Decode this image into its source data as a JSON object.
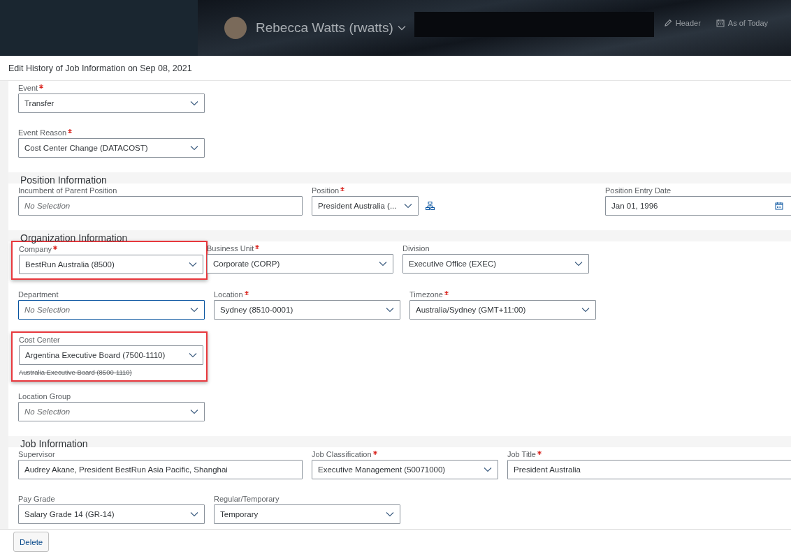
{
  "header": {
    "user_name": "Rebecca Watts (rwatts)",
    "actions": [
      {
        "kind": "edit",
        "label": "Header"
      },
      {
        "kind": "calendar",
        "label": "As of Today"
      }
    ]
  },
  "dialog": {
    "title": "Edit History of Job Information on Sep 08, 2021"
  },
  "sections": [
    {
      "rows": [
        {
          "fields": [
            {
              "label": "Event",
              "required": true,
              "kind": "select",
              "value": "Transfer"
            }
          ]
        },
        {
          "fields": [
            {
              "label": "Event Reason",
              "required": true,
              "kind": "select",
              "value": "Cost Center Change (DATACOST)"
            }
          ]
        }
      ]
    },
    {
      "title": "Position Information",
      "rows": [
        {
          "fields": [
            {
              "label": "Incumbent of Parent Position",
              "required": false,
              "kind": "input",
              "placeholder": "No Selection"
            },
            {
              "label": "Position",
              "required": true,
              "kind": "select-with-chart",
              "value": "President Australia (..."
            },
            {
              "label": "Position Entry Date",
              "required": false,
              "kind": "date",
              "value": "Jan 01, 1996"
            }
          ]
        }
      ]
    },
    {
      "title": "Organization Information",
      "rows": [
        {
          "fields": [
            {
              "label": "Company",
              "required": true,
              "kind": "select",
              "value": "BestRun Australia (8500)",
              "highlighted": true
            },
            {
              "label": "Business Unit",
              "required": true,
              "kind": "select",
              "value": "Corporate (CORP)"
            },
            {
              "label": "Division",
              "required": false,
              "kind": "select",
              "value": "Executive Office (EXEC)"
            }
          ]
        },
        {
          "fields": [
            {
              "label": "Department",
              "required": false,
              "kind": "select",
              "placeholder": "No Selection",
              "focused": true
            },
            {
              "label": "Location",
              "required": true,
              "kind": "select",
              "value": "Sydney (8510-0001)"
            },
            {
              "label": "Timezone",
              "required": true,
              "kind": "select",
              "value": "Australia/Sydney (GMT+11:00)"
            }
          ]
        },
        {
          "fields": [
            {
              "label": "Cost Center",
              "required": false,
              "kind": "select",
              "value": "Argentina Executive Board (7500-1110)",
              "previous_value": "Australia Executive Board (8500-1110)",
              "highlighted": true
            }
          ]
        },
        {
          "fields": [
            {
              "label": "Location Group",
              "required": false,
              "kind": "select",
              "placeholder": "No Selection"
            }
          ]
        }
      ]
    },
    {
      "title": "Job Information",
      "rows": [
        {
          "fields": [
            {
              "label": "Supervisor",
              "required": false,
              "kind": "input",
              "value": "Audrey Akane, President BestRun Asia Pacific, Shanghai"
            },
            {
              "label": "Job Classification",
              "required": true,
              "kind": "select",
              "value": "Executive Management (50071000)"
            },
            {
              "label": "Job Title",
              "required": true,
              "kind": "input",
              "value": "President Australia"
            }
          ]
        },
        {
          "fields": [
            {
              "label": "Pay Grade",
              "required": false,
              "kind": "select",
              "value": "Salary Grade 14 (GR-14)"
            },
            {
              "label": "Regular/Temporary",
              "required": false,
              "kind": "select",
              "value": "Temporary"
            }
          ]
        }
      ]
    }
  ],
  "footer": {
    "buttons": [
      {
        "label": "Delete"
      }
    ]
  }
}
